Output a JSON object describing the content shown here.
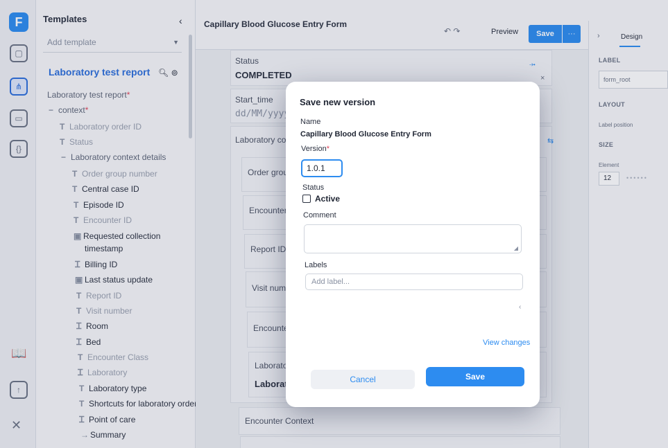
{
  "rail": {
    "logo": "F",
    "icons": [
      "page-icon",
      "tree-icon",
      "calendar-icon",
      "braces-icon",
      "book-icon",
      "upload-icon",
      "tools-icon"
    ]
  },
  "templates": {
    "header": "Templates",
    "collapse": "‹",
    "add_placeholder": "Add template",
    "title": "Laboratory test report",
    "tree": [
      {
        "label": "Laboratory test report",
        "req": "*"
      },
      {
        "label": "context",
        "req": "*",
        "prefix": "−"
      },
      {
        "label": "Laboratory order ID",
        "prefix": "T"
      },
      {
        "label": "Status",
        "prefix": "T"
      },
      {
        "label": "Laboratory context details",
        "prefix": "−"
      },
      {
        "label": "Order group number",
        "prefix": "T"
      },
      {
        "label": "Central case ID",
        "prefix": "T"
      },
      {
        "label": "Episode ID",
        "prefix": "T"
      },
      {
        "label": "Encounter ID",
        "prefix": "T"
      },
      {
        "label": "Requested collection",
        "prefix": "▣"
      },
      {
        "label": "timestamp",
        "prefix": ""
      },
      {
        "label": "Billing ID",
        "prefix": "Ꮖ"
      },
      {
        "label": "Last status update",
        "prefix": "▣"
      },
      {
        "label": "Report ID",
        "prefix": "T"
      },
      {
        "label": "Visit number",
        "prefix": "T"
      },
      {
        "label": "Room",
        "prefix": "Ꮖ"
      },
      {
        "label": "Bed",
        "prefix": "Ꮖ"
      },
      {
        "label": "Encounter Class",
        "prefix": "T"
      },
      {
        "label": "Laboratory",
        "prefix": "Ꮖ"
      },
      {
        "label": "Laboratory type",
        "prefix": "T"
      },
      {
        "label": "Shortcuts for laboratory order",
        "prefix": "T"
      },
      {
        "label": "Point of care",
        "prefix": "Ꮖ"
      },
      {
        "label": "Summary",
        "prefix": "→"
      }
    ]
  },
  "topbar": {
    "form_title": "Capillary Blood Glucose Entry Form",
    "undo": "↶ ↷",
    "preview": "Preview",
    "save": "Save",
    "more": "···"
  },
  "design": {
    "arrow": "›",
    "tab": "Design",
    "label_header": "LABEL",
    "label_value": "form_root",
    "layout_header": "LAYOUT",
    "label_position": "Label position",
    "size_header": "SIZE",
    "element": "Element",
    "element_value": "12",
    "dots": "••••••"
  },
  "canvas": {
    "status_label": "Status",
    "status_value": "COMPLETED",
    "start_time_label": "Start_time",
    "start_time_placeholder": "dd/MM/yyyy",
    "lab_context_label": "Laboratory con",
    "order_group": "Order group",
    "encounter_id": "Encounter I",
    "report_id": "Report ID",
    "visit_number": "Visit numbe",
    "encounter_c": "Encounter C",
    "laboratory_label": "Laboratory",
    "laboratory_value": "Laboratory",
    "encounter_context": "Encounter Context",
    "action": "⇆",
    "close": "×",
    "flow": "⤞"
  },
  "modal": {
    "title": "Save new version",
    "name_label": "Name",
    "name_value": "Capillary Blood Glucose Entry Form",
    "version_label": "Version",
    "version_req": "*",
    "version_value": "1.0.1",
    "status_label": "Status",
    "active_label": "Active",
    "active_checked": false,
    "comment_label": "Comment",
    "labels_label": "Labels",
    "labels_placeholder": "Add label...",
    "view_changes": "View changes",
    "cancel": "Cancel",
    "save": "Save"
  }
}
